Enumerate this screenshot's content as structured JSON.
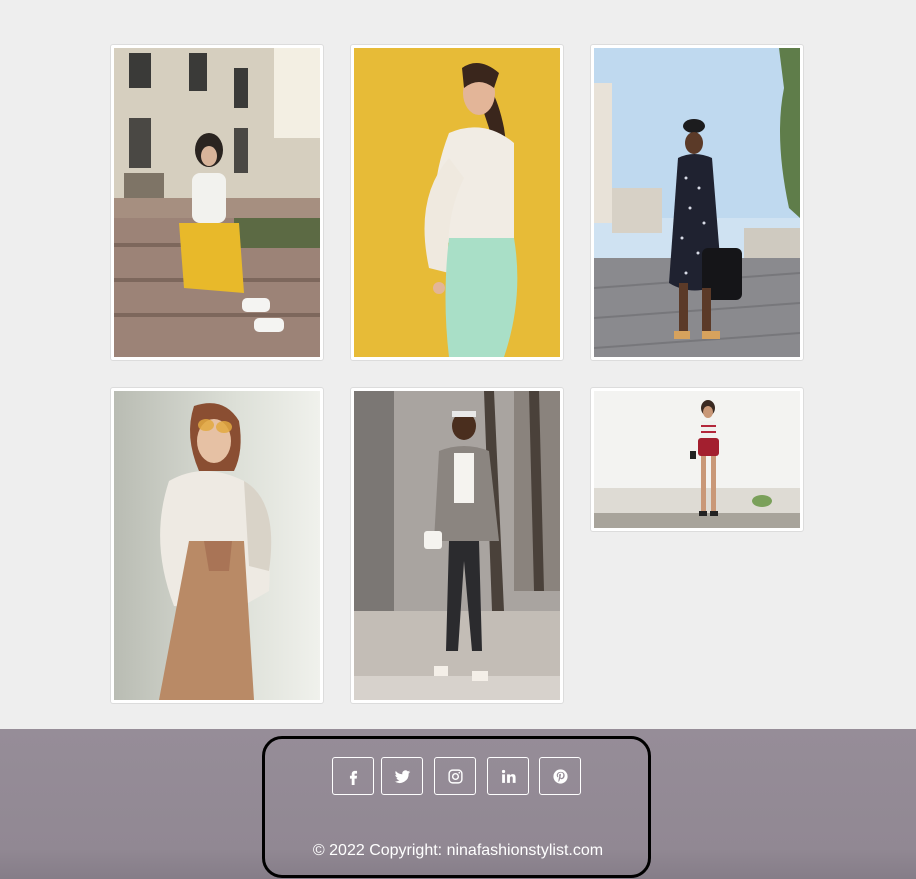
{
  "gallery": {
    "images": [
      {
        "name": "photo-woman-yellow-skirt-steps"
      },
      {
        "name": "photo-woman-lace-blouse-yellow-backdrop"
      },
      {
        "name": "photo-woman-polka-dot-dress"
      },
      {
        "name": "photo-woman-sunglasses-white-shirt"
      },
      {
        "name": "photo-woman-plaid-blazer-street"
      },
      {
        "name": "photo-woman-red-shorts-white-wall"
      }
    ]
  },
  "footer": {
    "social_icons": [
      "facebook-icon",
      "twitter-icon",
      "instagram-icon",
      "linkedin-icon",
      "pinterest-icon"
    ],
    "copyright_prefix": "© 2022 Copyright: ",
    "copyright_link": "ninafashionstylist.com"
  },
  "colors": {
    "page_background": "#eeeeee",
    "footer_background": "#968d98",
    "footer_border": "#000000",
    "footer_text": "#ffffff"
  }
}
